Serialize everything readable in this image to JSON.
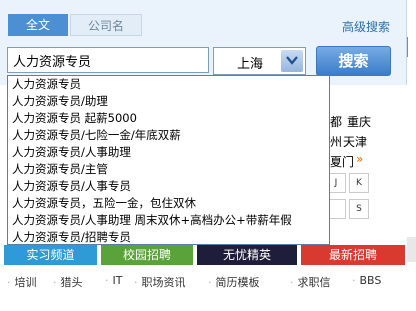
{
  "tabs": [
    {
      "label": "全文",
      "active": true
    },
    {
      "label": "公司名",
      "active": false
    }
  ],
  "advanced_search": "高级搜索",
  "search": {
    "value": "人力资源专员"
  },
  "city_select": {
    "value": "上海"
  },
  "search_button": "搜索",
  "cities": [
    "都",
    "重庆",
    "州",
    "天津",
    "夏门"
  ],
  "more_marker": "»",
  "letters": [
    "J",
    "K",
    "",
    "S"
  ],
  "suggestions": [
    "人力资源专员",
    "人力资源专员/助理",
    "人力资源专员 起薪5000",
    "人力资源专员/七险一金/年底双薪",
    "人力资源专员/人事助理",
    "人力资源专员/主管",
    "人力资源专员/人事专员",
    "人力资源专员，五险一金，包住双休",
    "人力资源专员/人事助理 周末双休+高档办公+带薪年假",
    "人力资源专员/招聘专员"
  ],
  "banners": [
    {
      "label": "实习频道",
      "color": "#2f9bd6"
    },
    {
      "label": "校园招聘",
      "color": "#5aa33a"
    },
    {
      "label": "无忧精英",
      "color": "#1e1e3a"
    },
    {
      "label": "最新招聘",
      "color": "#d93a2f"
    }
  ],
  "bottom_nav": [
    "培训",
    "猎头",
    "IT",
    "职场资讯",
    "简历模板",
    "求职信",
    "BBS"
  ]
}
